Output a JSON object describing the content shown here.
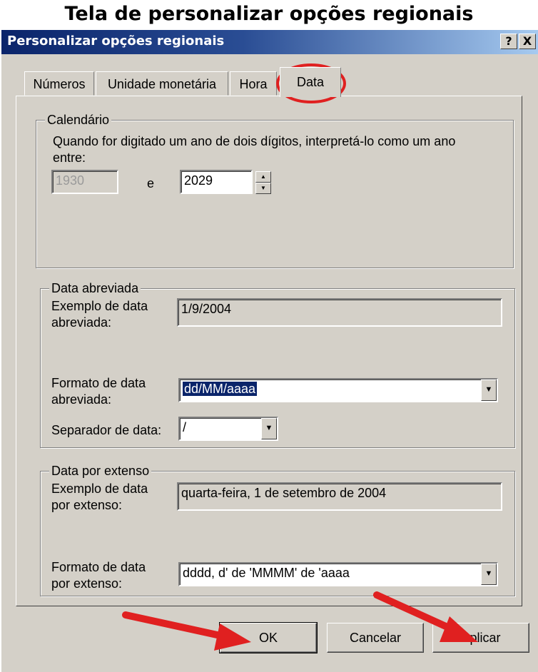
{
  "caption": "Tela de personalizar opções regionais",
  "window": {
    "title": "Personalizar opções regionais",
    "help_label": "?",
    "close_label": "X"
  },
  "tabs": [
    {
      "label": "Números"
    },
    {
      "label": "Unidade monetária"
    },
    {
      "label": "Hora"
    },
    {
      "label": "Data",
      "active": true
    }
  ],
  "calendar": {
    "legend": "Calendário",
    "description_line1": "Quando for digitado um ano de dois dígitos, interpretá-lo como um ano",
    "description_line2": "entre:",
    "year_from": "1930",
    "connector": "e",
    "year_to": "2029"
  },
  "short_date": {
    "legend": "Data abreviada",
    "example_label_line1": "Exemplo de data",
    "example_label_line2": "abreviada:",
    "example_value": "1/9/2004",
    "format_label_line1": "Formato de data",
    "format_label_line2": "abreviada:",
    "format_value": "dd/MM/aaaa",
    "separator_label": "Separador de data:",
    "separator_value": "/"
  },
  "long_date": {
    "legend": "Data por extenso",
    "example_label_line1": "Exemplo de data",
    "example_label_line2": "por extenso:",
    "example_value": "quarta-feira, 1 de setembro de 2004",
    "format_label_line1": "Formato de data",
    "format_label_line2": "por extenso:",
    "format_value": "dddd, d' de 'MMMM' de 'aaaa"
  },
  "buttons": {
    "ok": "OK",
    "cancel": "Cancelar",
    "apply": "Aplicar"
  },
  "colors": {
    "title_gradient_start": "#0a246a",
    "title_gradient_end": "#a6caf0",
    "dialog_face": "#d4d0c8",
    "highlight_ellipse": "#e02020",
    "annotation_arrow": "#e02020"
  }
}
